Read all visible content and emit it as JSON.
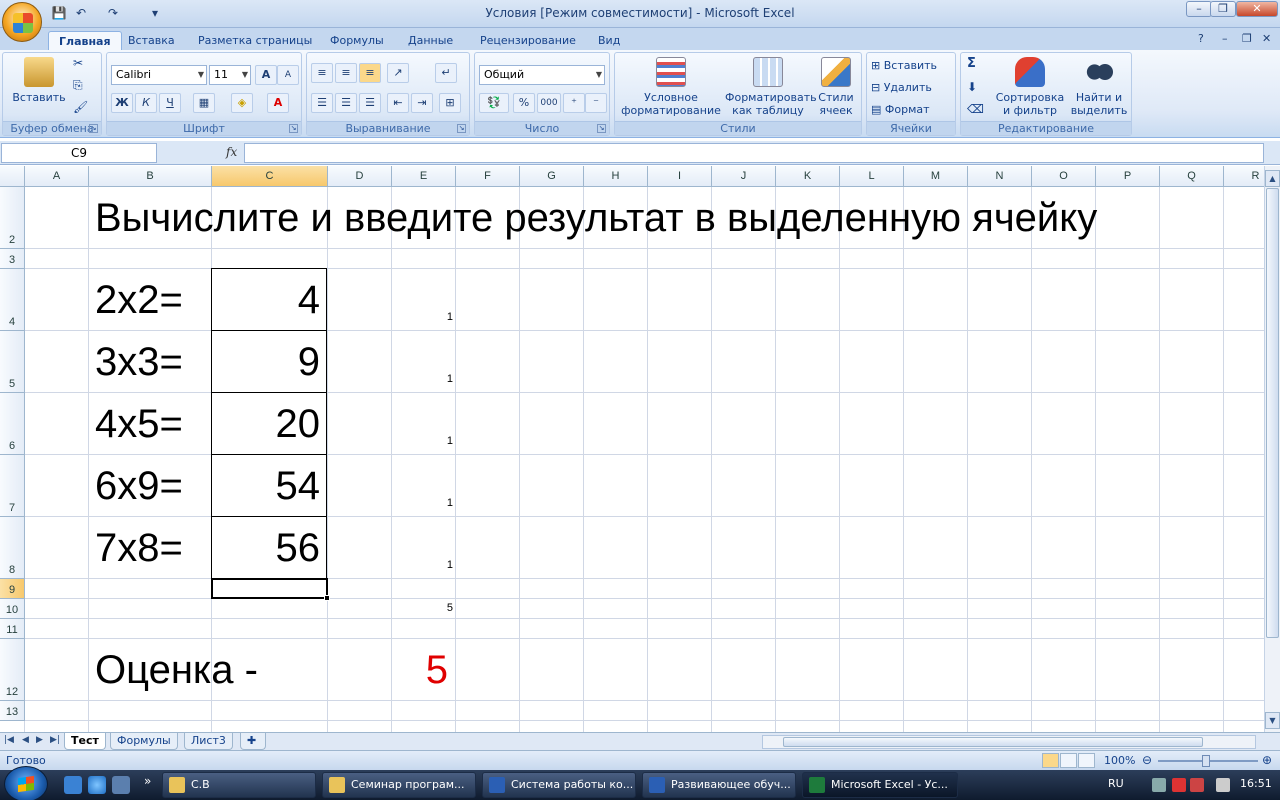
{
  "window": {
    "title": "Условия  [Режим совместимости] - Microsoft Excel",
    "minimize": "–",
    "restore": "❐",
    "close": "✕"
  },
  "ribbon": {
    "tabs": [
      "Главная",
      "Вставка",
      "Разметка страницы",
      "Формулы",
      "Данные",
      "Рецензирование",
      "Вид"
    ],
    "clipboard": {
      "paste": "Вставить",
      "group": "Буфер обмена"
    },
    "font": {
      "name": "Calibri",
      "size": "11",
      "group": "Шрифт",
      "bold": "Ж",
      "italic": "К",
      "underline": "Ч",
      "grow": "A",
      "shrink": "A"
    },
    "alignment": {
      "group": "Выравнивание"
    },
    "number": {
      "format": "Общий",
      "percent": "%",
      "thousands": "000",
      "group": "Число"
    },
    "styles": {
      "conditional": [
        "Условное",
        "форматирование"
      ],
      "table": [
        "Форматировать",
        "как таблицу"
      ],
      "cell": [
        "Стили",
        "ячеек"
      ],
      "group": "Стили"
    },
    "cells": {
      "insert": "Вставить",
      "delete": "Удалить",
      "format": "Формат",
      "group": "Ячейки"
    },
    "editing": {
      "sum": "Σ",
      "sort": [
        "Сортировка",
        "и фильтр"
      ],
      "find": [
        "Найти и",
        "выделить"
      ],
      "group": "Редактирование"
    }
  },
  "formula_bar": {
    "name_box": "C9",
    "fx": "fx",
    "value": ""
  },
  "columns": [
    "A",
    "B",
    "C",
    "D",
    "E",
    "F",
    "G",
    "H",
    "I",
    "J",
    "K",
    "L",
    "M",
    "N",
    "O",
    "P",
    "Q",
    "R"
  ],
  "rows": [
    "2",
    "3",
    "4",
    "5",
    "6",
    "7",
    "8",
    "9",
    "10",
    "11",
    "12",
    "13"
  ],
  "sheet": {
    "heading": "Вычислите и введите результат в выделенную ячейку",
    "tasks": [
      {
        "question": "2x2=",
        "answer": "4",
        "score": "1"
      },
      {
        "question": "3x3=",
        "answer": "9",
        "score": "1"
      },
      {
        "question": "4x5=",
        "answer": "20",
        "score": "1"
      },
      {
        "question": "6x9=",
        "answer": "54",
        "score": "1"
      },
      {
        "question": "7x8=",
        "answer": "56",
        "score": "1"
      }
    ],
    "total": "5",
    "grade_label": "Оценка -",
    "grade_value": "5",
    "grade_color": "#e00000"
  },
  "sheet_tabs": [
    "Тест",
    "Формулы",
    "Лист3"
  ],
  "status": {
    "ready": "Готово",
    "zoom": "100%"
  },
  "taskbar": {
    "items": [
      "С.В",
      "Семинар програм...",
      "Система работы ко...",
      "Развивающее обуч...",
      "Microsoft Excel - Ус..."
    ],
    "lang": "RU",
    "clock": "16:51"
  },
  "colors": {
    "accent": "#15428b",
    "selection": "#f7c86c"
  }
}
